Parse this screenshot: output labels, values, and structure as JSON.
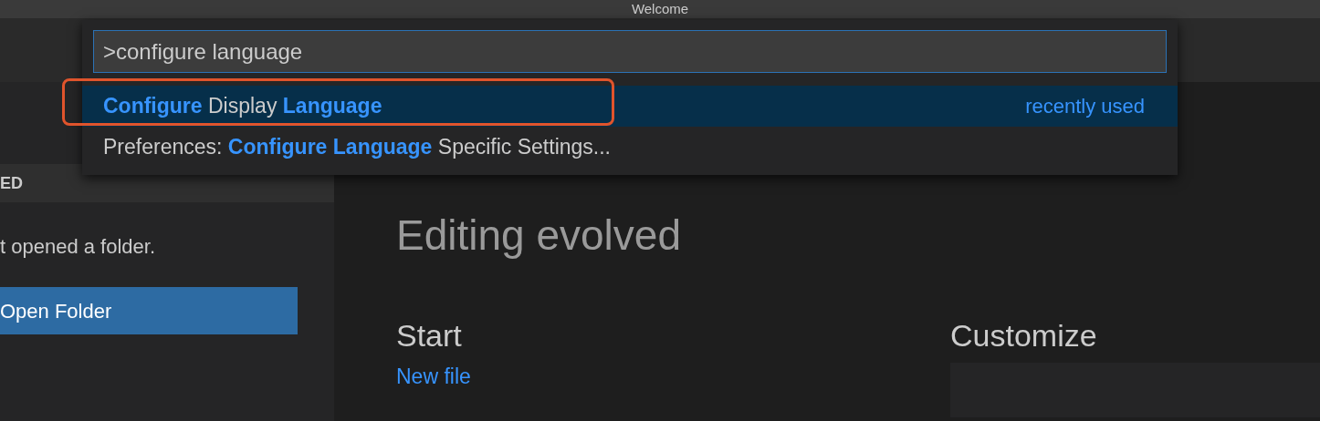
{
  "window": {
    "title": "Welcome"
  },
  "sidebar": {
    "header": "ED",
    "message": "t opened a folder.",
    "button": "Open Folder"
  },
  "welcome": {
    "subtitle": "Editing evolved",
    "start": {
      "heading": "Start",
      "links": [
        "New file"
      ]
    },
    "customize": {
      "heading": "Customize"
    }
  },
  "command_palette": {
    "value": ">configure language",
    "items": [
      {
        "label": "**Configure** Display **Language**",
        "detail": "recently used",
        "selected": true,
        "highlighted": true
      },
      {
        "label": "Preferences: **Configure Language** Specific Settings...",
        "selected": false,
        "highlighted": false
      }
    ]
  }
}
